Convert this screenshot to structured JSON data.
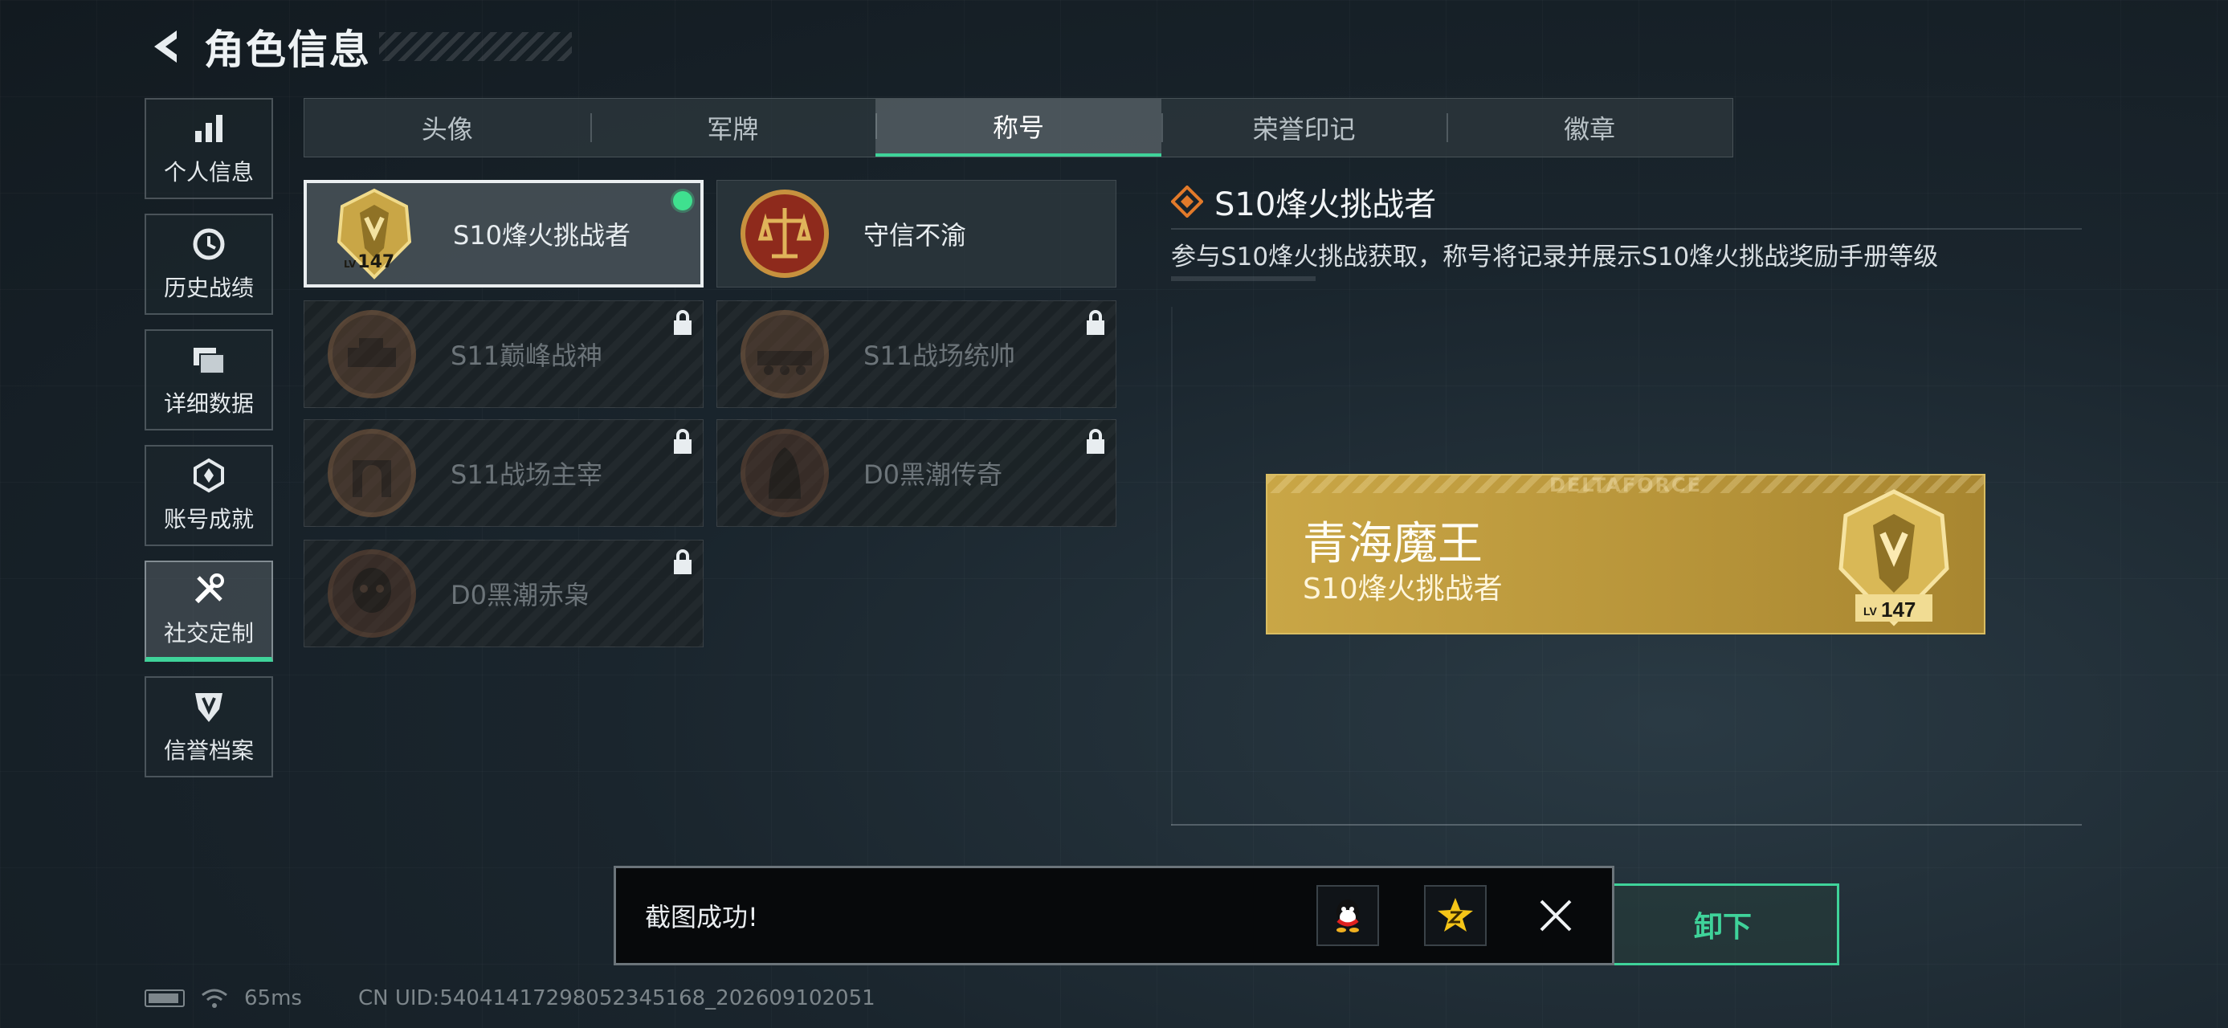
{
  "header": {
    "title": "角色信息"
  },
  "sidenav": {
    "items": [
      {
        "label": "个人信息",
        "icon": "bar-chart-icon"
      },
      {
        "label": "历史战绩",
        "icon": "clock-icon"
      },
      {
        "label": "详细数据",
        "icon": "folder-icon"
      },
      {
        "label": "账号成就",
        "icon": "achievement-icon"
      },
      {
        "label": "社交定制",
        "icon": "tools-icon",
        "active": true
      },
      {
        "label": "信誉档案",
        "icon": "shield-icon"
      }
    ]
  },
  "tabs": [
    {
      "label": "头像"
    },
    {
      "label": "军牌"
    },
    {
      "label": "称号",
      "active": true
    },
    {
      "label": "荣誉印记"
    },
    {
      "label": "徽章"
    }
  ],
  "titles": [
    {
      "label": "S10烽火挑战者",
      "level": "147",
      "lv_prefix": "LV",
      "selected": true,
      "equipped": true,
      "locked": false
    },
    {
      "label": "守信不渝",
      "locked": false
    },
    {
      "label": "S11巅峰战神",
      "locked": true
    },
    {
      "label": "S11战场统帅",
      "locked": true
    },
    {
      "label": "S11战场主宰",
      "locked": true
    },
    {
      "label": "D0黑潮传奇",
      "locked": true
    },
    {
      "label": "D0黑潮赤枭",
      "locked": true
    }
  ],
  "detail": {
    "title": "S10烽火挑战者",
    "description": "参与S10烽火挑战获取，称号将记录并展示S10烽火挑战奖励手册等级"
  },
  "nameplate": {
    "brand": "DELTAFORCE",
    "player_name": "青海魔王",
    "title": "S10烽火挑战者",
    "level": "147",
    "lv_prefix": "LV",
    "color": "#c9a646"
  },
  "unequip_button": {
    "label": "卸下"
  },
  "toast": {
    "text": "截图成功!",
    "share_targets": [
      "qq-icon",
      "qzone-star-icon"
    ]
  },
  "status": {
    "latency": "65ms",
    "uid": "CN UID:5404141729805234516​8_202609102051"
  },
  "colors": {
    "accent": "#3fd39a",
    "gold": "#c9a646"
  }
}
